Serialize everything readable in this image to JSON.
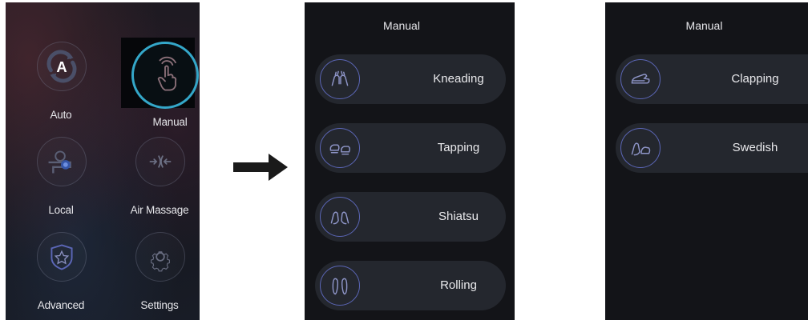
{
  "home": {
    "tiles": [
      {
        "label": "Auto",
        "icon": "auto-a-icon"
      },
      {
        "label": "Manual",
        "icon": "hand-tap-icon"
      },
      {
        "label": "Local",
        "icon": "local-roller-icon"
      },
      {
        "label": "Air Massage",
        "icon": "air-massage-icon"
      },
      {
        "label": "Advanced",
        "icon": "shield-star-icon"
      },
      {
        "label": "Settings",
        "icon": "gear-icon"
      }
    ],
    "selected": "Manual",
    "selected_color": "#34a7c9"
  },
  "transition_arrow": "right-arrow-icon",
  "manual_page_1": {
    "title": "Manual",
    "items": [
      {
        "label": "Kneading",
        "icon": "kneading-hands-icon"
      },
      {
        "label": "Tapping",
        "icon": "tapping-fists-icon"
      },
      {
        "label": "Shiatsu",
        "icon": "shiatsu-thumbs-icon"
      },
      {
        "label": "Rolling",
        "icon": "rolling-feet-icon"
      }
    ]
  },
  "manual_page_2": {
    "title": "Manual",
    "items": [
      {
        "label": "Clapping",
        "icon": "clapping-hand-icon"
      },
      {
        "label": "Swedish",
        "icon": "swedish-hand-icon"
      }
    ]
  },
  "colors": {
    "accent": "#34a7c9",
    "button_bg": "#24272e",
    "icon_ring": "#5b66b6",
    "panel_bg": "#131418"
  }
}
